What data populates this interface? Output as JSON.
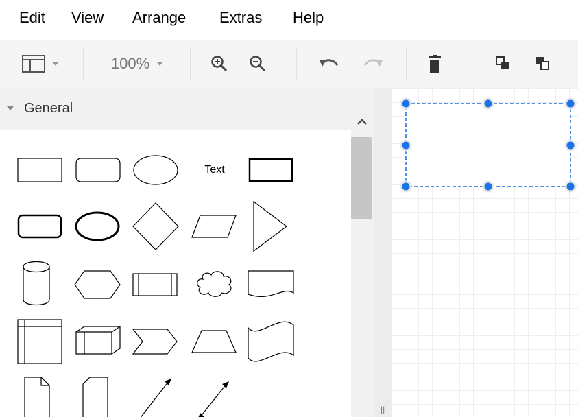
{
  "menu": [
    "Edit",
    "View",
    "Arrange",
    "Extras",
    "Help"
  ],
  "toolbar": {
    "format_panel_icon": "panel-layout-icon",
    "zoom_value": "100%",
    "zoom_in_icon": "zoom-in-icon",
    "zoom_out_icon": "zoom-out-icon",
    "undo_icon": "undo-icon",
    "redo_icon": "redo-icon",
    "delete_icon": "trash-icon",
    "to_front_icon": "to-front-icon",
    "to_back_icon": "to-back-icon"
  },
  "sidebar": {
    "section_title": "General",
    "text_shape_label": "Text",
    "shapes": [
      "rectangle",
      "rounded-rectangle",
      "ellipse",
      "text",
      "bold-rectangle",
      "bold-rounded-rectangle",
      "bold-ellipse",
      "diamond",
      "parallelogram",
      "triangle",
      "cylinder",
      "hexagon",
      "process",
      "cloud",
      "document",
      "internal-storage",
      "cube",
      "step",
      "trapezoid",
      "tape",
      "note",
      "card",
      "arrow",
      "bidirectional-arrow"
    ]
  },
  "colors": {
    "selection_handle": "#1a73e8",
    "selection_border": "#1a73e8",
    "grid": "#eeeeee",
    "toolbar_bg": "#f5f5f5"
  }
}
